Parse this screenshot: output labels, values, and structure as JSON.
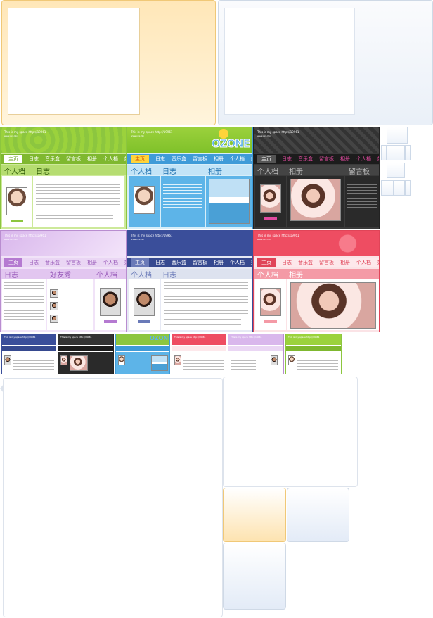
{
  "skin_header": {
    "line1": "This is my space http://19961",
    "line2": "www.xxx.l9x"
  },
  "nav": {
    "home": "主页",
    "blog": "日志",
    "music": "音乐盒",
    "guestbook": "留言板",
    "album": "相册",
    "profile": "个人档",
    "friends": "好友"
  },
  "sections": {
    "profile": "个人档",
    "blog": "日志",
    "album": "相册",
    "guestbook": "留言板",
    "friends_show": "好友秀"
  },
  "logo": {
    "text": "OZONE"
  },
  "colors": {
    "green": "#8cc63f",
    "sky": "#55b0e6",
    "black": "#2a2a2a",
    "lavender": "#d7b3e8",
    "navy": "#3a4e9a",
    "red": "#f0566b",
    "orange_panel": "#fde3b0",
    "blue_panel": "#e8eef8"
  }
}
